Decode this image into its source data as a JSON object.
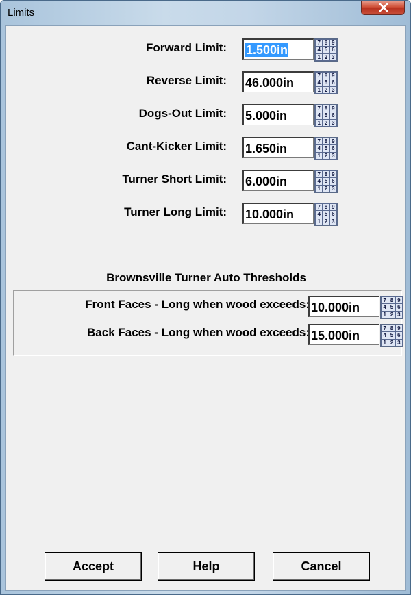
{
  "window": {
    "title": "Limits"
  },
  "limits": [
    {
      "label": "Forward Limit:",
      "value": "1.500in",
      "selected": true
    },
    {
      "label": "Reverse Limit:",
      "value": "46.000in"
    },
    {
      "label": "Dogs-Out Limit:",
      "value": "5.000in"
    },
    {
      "label": "Cant-Kicker Limit:",
      "value": "1.650in"
    },
    {
      "label": "Turner Short Limit:",
      "value": "6.000in"
    },
    {
      "label": "Turner Long Limit:",
      "value": "10.000in"
    }
  ],
  "thresholds": {
    "title": "Brownsville Turner Auto Thresholds",
    "rows": [
      {
        "label": "Front Faces - Long when wood exceeds:",
        "value": "10.000in"
      },
      {
        "label": "Back Faces - Long when wood exceeds:",
        "value": "15.000in"
      }
    ]
  },
  "keypad": {
    "keys": [
      "7",
      "8",
      "9",
      "4",
      "5",
      "6",
      "1",
      "2",
      "3"
    ],
    "icon": "numeric-keypad-icon"
  },
  "buttons": {
    "accept": "Accept",
    "help": "Help",
    "cancel": "Cancel"
  },
  "colors": {
    "selection": "#3399ff",
    "close_button": "#c8503a"
  }
}
